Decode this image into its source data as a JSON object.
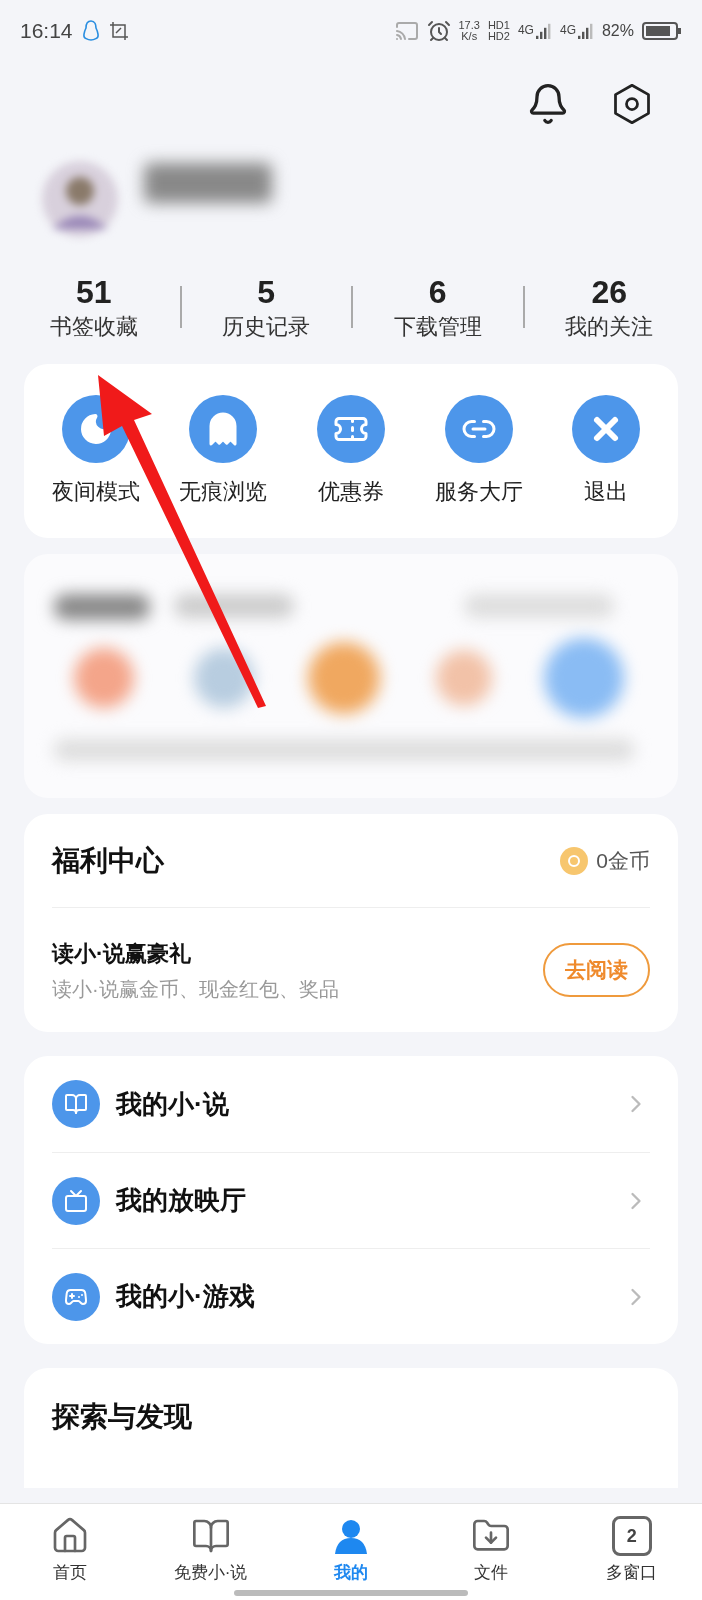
{
  "status_bar": {
    "time": "16:14",
    "speed": "17.3",
    "speed_unit": "K/s",
    "hd": [
      "HD1",
      "HD2"
    ],
    "network": [
      "4G",
      "4G"
    ],
    "battery": "82%"
  },
  "stats": [
    {
      "value": "51",
      "label": "书签收藏"
    },
    {
      "value": "5",
      "label": "历史记录"
    },
    {
      "value": "6",
      "label": "下载管理"
    },
    {
      "value": "26",
      "label": "我的关注"
    }
  ],
  "quick_actions": [
    {
      "label": "夜间模式",
      "kind": "night"
    },
    {
      "label": "无痕浏览",
      "kind": "ghost"
    },
    {
      "label": "优惠券",
      "kind": "ticket"
    },
    {
      "label": "服务大厅",
      "kind": "service"
    },
    {
      "label": "退出",
      "kind": "exit"
    }
  ],
  "welfare": {
    "title": "福利中心",
    "coins": "0金币",
    "task_title": "读小·说赢豪礼",
    "task_subtitle": "读小·说赢金币、现金红包、奖品",
    "button": "去阅读"
  },
  "menu": [
    {
      "label": "我的小·说",
      "kind": "novel"
    },
    {
      "label": "我的放映厅",
      "kind": "theater"
    },
    {
      "label": "我的小·游戏",
      "kind": "game"
    }
  ],
  "explore": {
    "title": "探索与发现"
  },
  "nav": [
    {
      "label": "首页",
      "kind": "home",
      "selected": false
    },
    {
      "label": "免费小·说",
      "kind": "book",
      "selected": false
    },
    {
      "label": "我的",
      "kind": "user",
      "selected": true
    },
    {
      "label": "文件",
      "kind": "file",
      "selected": false
    },
    {
      "label": "多窗口",
      "kind": "windows",
      "count": "2",
      "selected": false
    }
  ]
}
